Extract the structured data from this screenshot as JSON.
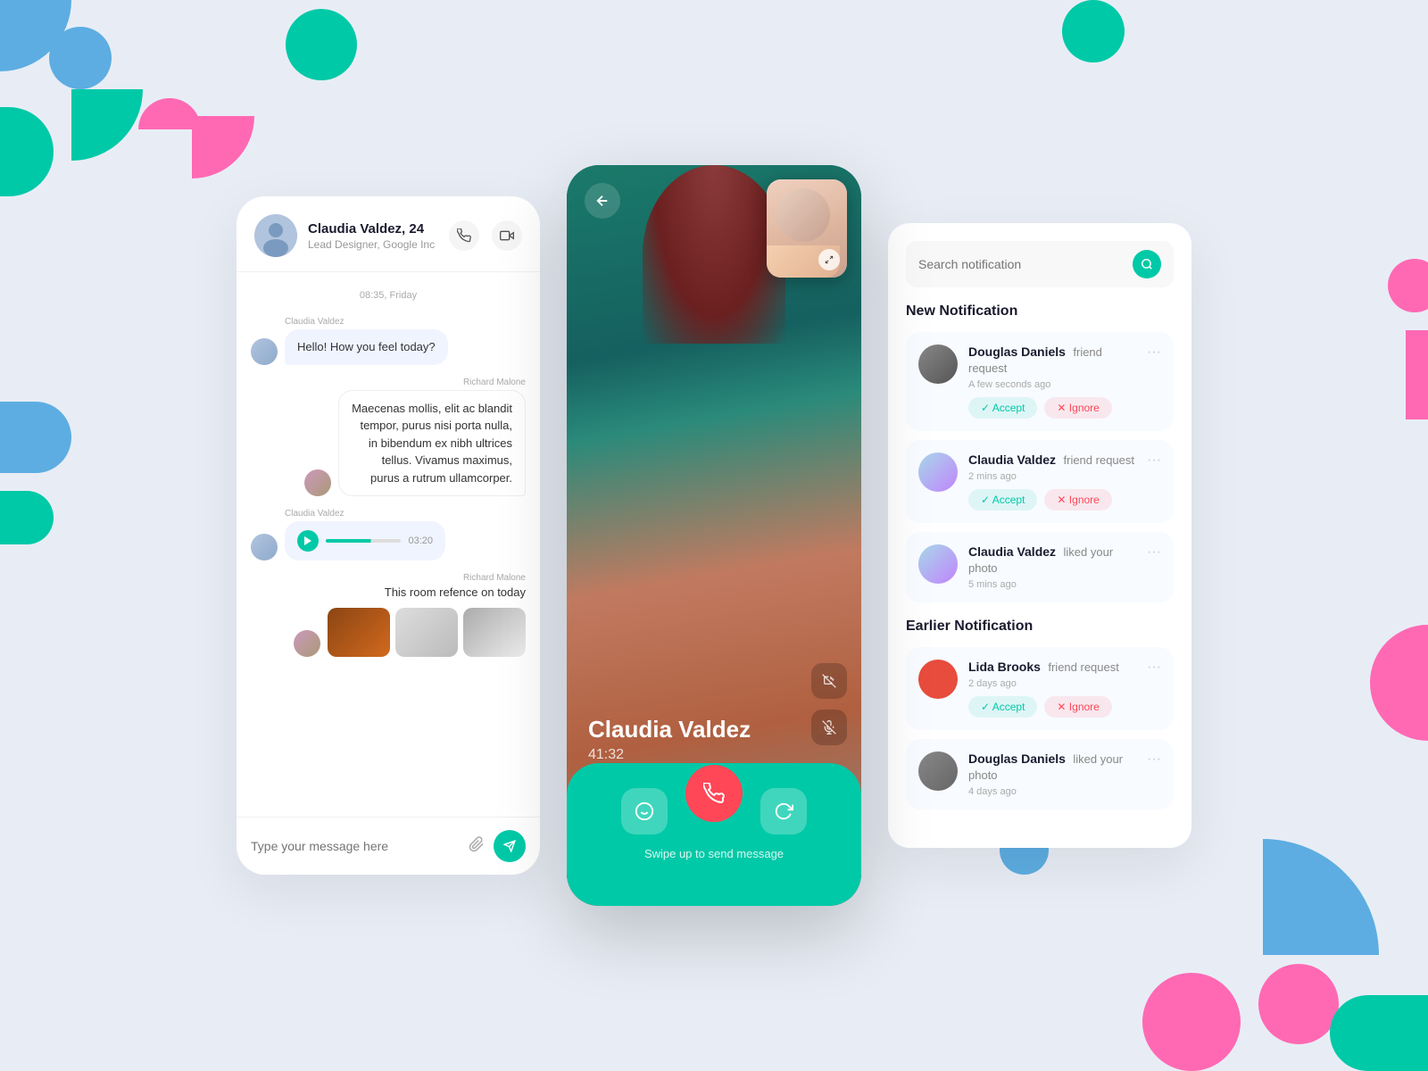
{
  "background": "#e8edf5",
  "chat": {
    "header": {
      "name": "Claudia Valdez, 24",
      "subtitle": "Lead Designer, Google Inc"
    },
    "date_label": "08:35, Friday",
    "messages": [
      {
        "id": 1,
        "sender": "Claudia Valdez",
        "side": "left",
        "type": "text",
        "text": "Hello! How you feel today?"
      },
      {
        "id": 2,
        "sender": "Richard Malone",
        "side": "right",
        "type": "text",
        "text": "Maecenas mollis, elit ac blandit tempor, purus nisi porta nulla, in bibendum ex nibh ultrices tellus. Vivamus maximus, purus a rutrum ullamcorper."
      },
      {
        "id": 3,
        "sender": "Claudia Valdez",
        "side": "left",
        "type": "audio",
        "duration": "03:20"
      },
      {
        "id": 4,
        "sender": "Richard Malone",
        "side": "right",
        "type": "images",
        "caption": "This room refence on today"
      }
    ],
    "input_placeholder": "Type your message here"
  },
  "call": {
    "caller_name": "Claudia Valdez",
    "duration": "41:32",
    "swipe_label": "Swipe up to send message"
  },
  "notifications": {
    "search_placeholder": "Search notification",
    "new_section": "New Notification",
    "earlier_section": "Earlier Notification",
    "new_items": [
      {
        "id": 1,
        "name": "Douglas Daniels",
        "action": "friend request",
        "time": "A few seconds ago",
        "has_buttons": true
      },
      {
        "id": 2,
        "name": "Claudia Valdez",
        "action": "friend request",
        "time": "2 mins ago",
        "has_buttons": true
      },
      {
        "id": 3,
        "name": "Claudia Valdez",
        "action": "liked your photo",
        "time": "5 mins ago",
        "has_buttons": false
      }
    ],
    "earlier_items": [
      {
        "id": 4,
        "name": "Lida Brooks",
        "action": "friend request",
        "time": "2 days ago",
        "has_buttons": true
      },
      {
        "id": 5,
        "name": "Douglas Daniels",
        "action": "liked your photo",
        "time": "4 days ago",
        "has_buttons": false
      }
    ],
    "accept_label": "Accept",
    "ignore_label": "Ignore"
  }
}
